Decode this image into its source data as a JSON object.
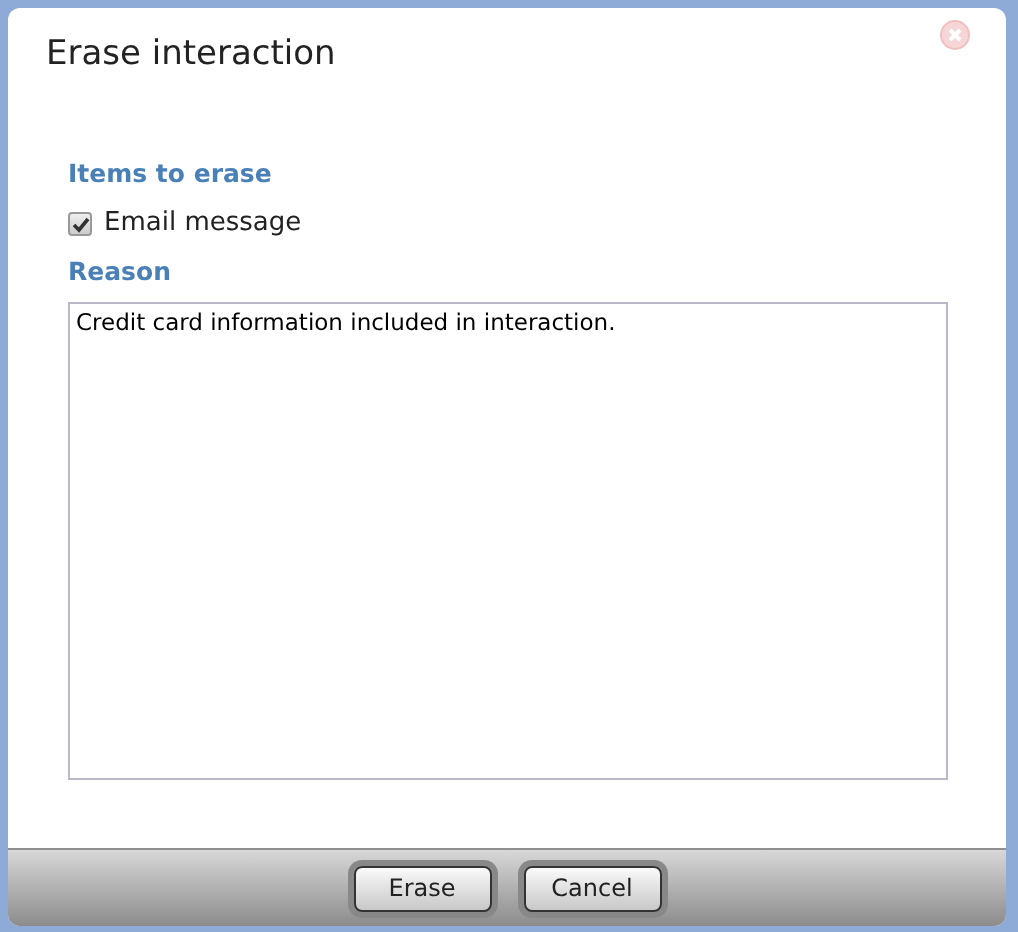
{
  "dialog": {
    "title": "Erase interaction",
    "items_heading": "Items to erase",
    "items": [
      {
        "label": "Email message",
        "checked": true
      }
    ],
    "reason_heading": "Reason",
    "reason": {
      "value": "Credit card information included in interaction."
    },
    "buttons": [
      {
        "label": "Erase"
      },
      {
        "label": "Cancel"
      }
    ]
  }
}
